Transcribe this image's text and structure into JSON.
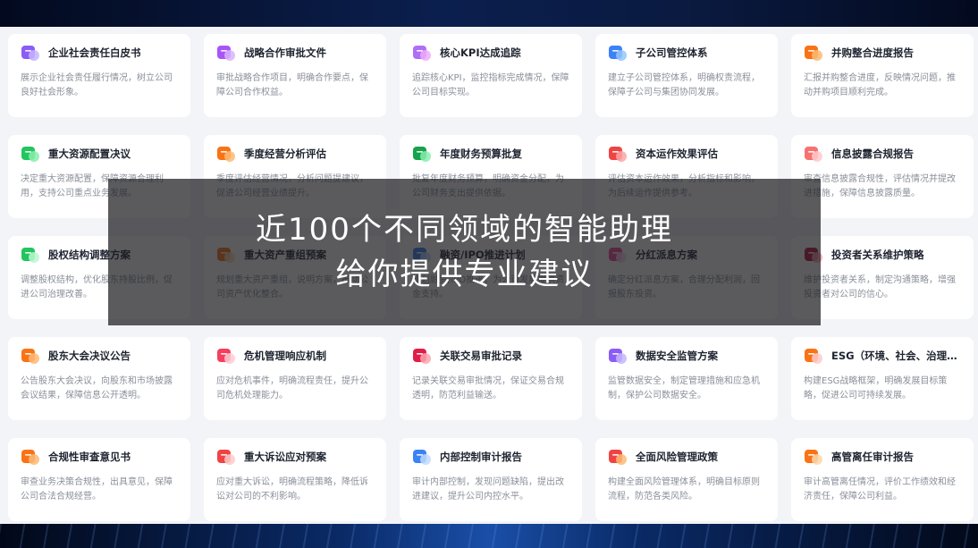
{
  "cards": [
    {
      "title": "企业社会责任白皮书",
      "desc": "展示企业社会责任履行情况，树立公司良好社会形象。",
      "icon": "chat-bubble-icon",
      "color": "#8b5cf6",
      "color2": "#c4b5fd"
    },
    {
      "title": "战略合作审批文件",
      "desc": "审批战略合作项目，明确合作要点，保障公司合作权益。",
      "icon": "contract-document-icon",
      "color": "#a855f7",
      "color2": "#d8b4fe"
    },
    {
      "title": "核心KPI达成追踪",
      "desc": "追踪核心KPI，监控指标完成情况，保障公司目标实现。",
      "icon": "chat-dots-icon",
      "color": "#b06ef5",
      "color2": "#f0abfc"
    },
    {
      "title": "子公司管控体系",
      "desc": "建立子公司管控体系，明确权责流程，保障子公司与集团协同发展。",
      "icon": "magnifier-icon",
      "color": "#3b82f6",
      "color2": "#93c5fd"
    },
    {
      "title": "并购整合进度报告",
      "desc": "汇报并购整合进度，反映情况问题，推动并购项目顺利完成。",
      "icon": "report-chart-icon",
      "color": "#f97316",
      "color2": "#fdba74"
    },
    {
      "title": "重大资源配置决议",
      "desc": "决定重大资源配置，保障资源合理利用，支持公司重点业务发展。",
      "icon": "speech-bubble-icon",
      "color": "#22c55e",
      "color2": "#86efac"
    },
    {
      "title": "季度经营分析评估",
      "desc": "季度评估经营情况，分析问题提建议，促进公司经营业绩提升。",
      "icon": "gear-icon",
      "color": "#f97316",
      "color2": "#fdba74"
    },
    {
      "title": "年度财务预算批复",
      "desc": "批复年度财务预算，明确资金分配，为公司财务支出提供依据。",
      "icon": "wallet-icon",
      "color": "#16a34a",
      "color2": "#86efac"
    },
    {
      "title": "资本运作效果评估",
      "desc": "评估资本运作效果，分析指标和影响，为后续运作提供参考。",
      "icon": "star-icon",
      "color": "#ef4444",
      "color2": "#fca5a5"
    },
    {
      "title": "信息披露合规报告",
      "desc": "审查信息披露合规性，评估情况并提改进措施，保障信息披露质量。",
      "icon": "bar-chart-icon",
      "color": "#f87171",
      "color2": "#fecaca"
    },
    {
      "title": "股权结构调整方案",
      "desc": "调整股权结构，优化股东持股比例，促进公司治理改善。",
      "icon": "shopping-cart-icon",
      "color": "#22c55e",
      "color2": "#bbf7d0"
    },
    {
      "title": "重大资产重组预案",
      "desc": "规划重大资产重组，说明方案，推动公司资产优化整合。",
      "icon": "building-icon",
      "color": "#f97316",
      "color2": "#fed7aa"
    },
    {
      "title": "融资/IPO推进计划",
      "desc": "规划融资/IPO推进，为公司发展提供资金支持。",
      "icon": "upload-icon",
      "color": "#3b82f6",
      "color2": "#bfdbfe"
    },
    {
      "title": "分红派息方案",
      "desc": "确定分红派息方案，合理分配利润，回报股东投资。",
      "icon": "trend-chart-icon",
      "color": "#ec4899",
      "color2": "#fbcfe8"
    },
    {
      "title": "投资者关系维护策略",
      "desc": "维护投资者关系，制定沟通策略，增强投资者对公司的信心。",
      "icon": "heart-icon",
      "color": "#be123c",
      "color2": "#fda4af"
    },
    {
      "title": "股东大会决议公告",
      "desc": "公告股东大会决议，向股东和市场披露会议结果，保障信息公开透明。",
      "icon": "megaphone-icon",
      "color": "#f97316",
      "color2": "#fdba74"
    },
    {
      "title": "危机管理响应机制",
      "desc": "应对危机事件，明确流程责任，提升公司危机处理能力。",
      "icon": "flag-icon",
      "color": "#f43f5e",
      "color2": "#fecdd3"
    },
    {
      "title": "关联交易审批记录",
      "desc": "记录关联交易审批情况，保证交易合规透明，防范利益输送。",
      "icon": "flower-icon",
      "color": "#e11d48",
      "color2": "#fda4af"
    },
    {
      "title": "数据安全监管方案",
      "desc": "监管数据安全，制定管理措施和应急机制，保护公司数据安全。",
      "icon": "shield-icon",
      "color": "#8b5cf6",
      "color2": "#c4b5fd"
    },
    {
      "title": "ESG（环境、社会、治理）…",
      "desc": "构建ESG战略框架，明确发展目标策略，促进公司可持续发展。",
      "icon": "analytics-icon",
      "color": "#f97316",
      "color2": "#fecaca"
    },
    {
      "title": "合规性审查意见书",
      "desc": "审查业务决策合规性，出具意见，保障公司合法合规经营。",
      "icon": "paper-plane-icon",
      "color": "#f97316",
      "color2": "#fdba74"
    },
    {
      "title": "重大诉讼应对预案",
      "desc": "应对重大诉讼，明确流程策略，降低诉讼对公司的不利影响。",
      "icon": "pie-icon",
      "color": "#ef4444",
      "color2": "#fecaca"
    },
    {
      "title": "内部控制审计报告",
      "desc": "审计内部控制，发现问题缺陷，提出改进建议，提升公司内控水平。",
      "icon": "pin-icon",
      "color": "#3b82f6",
      "color2": "#bfdbfe"
    },
    {
      "title": "全面风险管理政策",
      "desc": "构建全面风险管理体系，明确目标原则流程，防范各类风险。",
      "icon": "radar-icon",
      "color": "#ef4444",
      "color2": "#fdba74"
    },
    {
      "title": "高管离任审计报告",
      "desc": "审计高管离任情况，评价工作绩效和经济责任，保障公司利益。",
      "icon": "moon-icon",
      "color": "#f97316",
      "color2": "#fed7aa"
    }
  ],
  "overlay": {
    "line1": "近100个不同领域的智能助理",
    "line2": "给你提供专业建议"
  }
}
